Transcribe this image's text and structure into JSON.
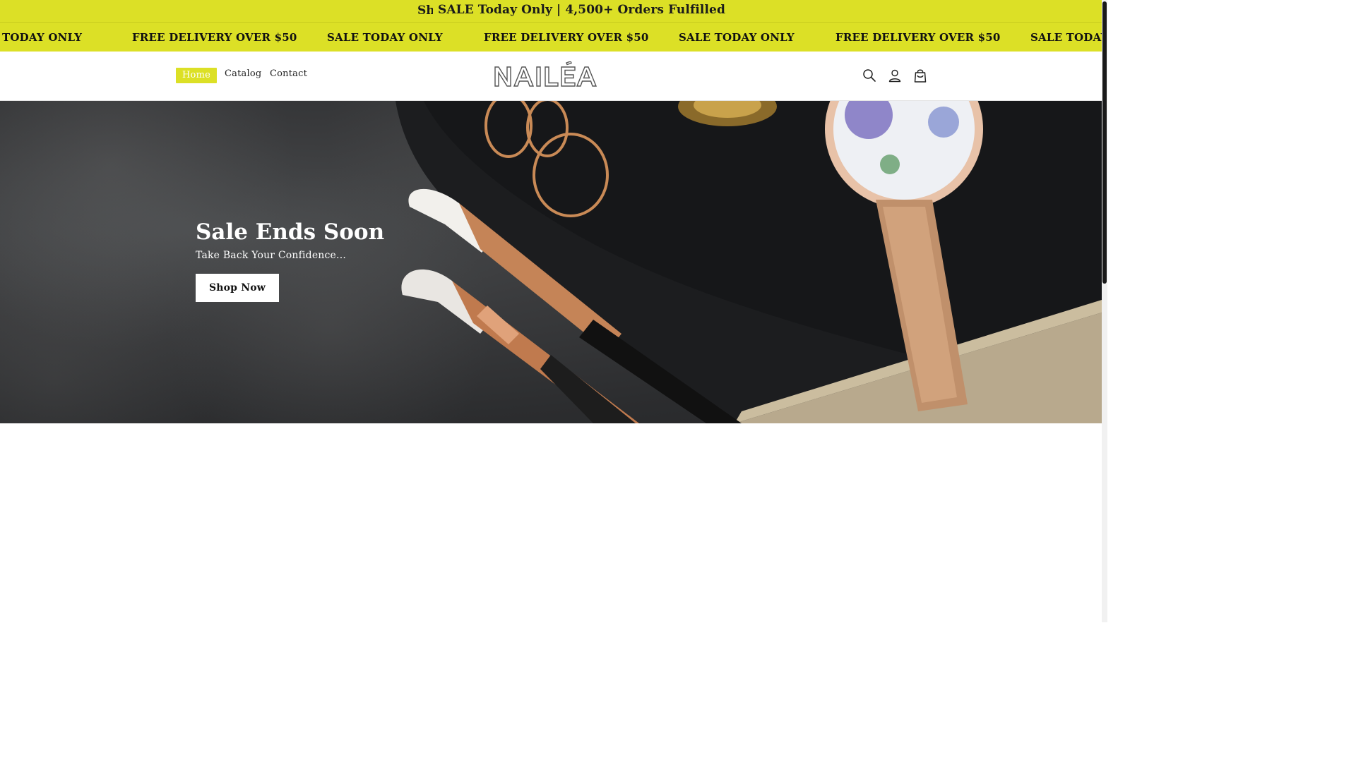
{
  "announcement": {
    "ghost_text": "Shop",
    "message": "SALE Today Only | 4,500+ Orders Fulfilled"
  },
  "marquee": {
    "items": [
      "E TODAY ONLY",
      "FREE DELIVERY OVER $50",
      "SALE TODAY ONLY",
      "FREE DELIVERY OVER $50",
      "SALE TODAY ONLY",
      "FREE DELIVERY OVER $50",
      "SALE TODAY"
    ]
  },
  "header": {
    "nav": [
      {
        "label": "Home",
        "active": true
      },
      {
        "label": "Catalog",
        "active": false
      },
      {
        "label": "Contact",
        "active": false
      }
    ],
    "logo_text": "NAILÉA",
    "icons": [
      "search-icon",
      "account-icon",
      "cart-icon"
    ]
  },
  "hero": {
    "title": "Sale Ends Soon",
    "subtitle": "Take Back Your Confidence...",
    "button_label": "Shop Now"
  },
  "colors": {
    "accent": "#dce026",
    "hero_bg": "#2c2d2f",
    "text_dark": "#1a1a1a",
    "white": "#ffffff"
  }
}
